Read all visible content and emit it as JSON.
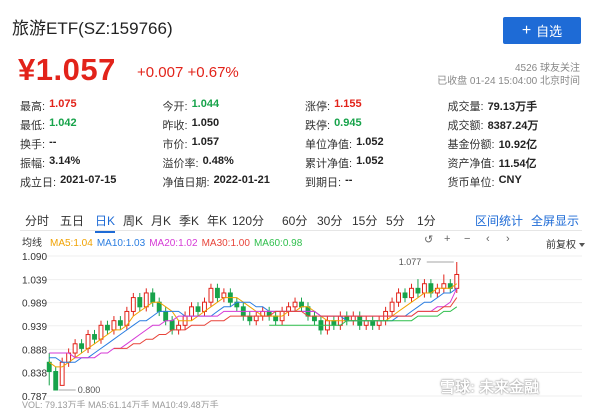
{
  "header": {
    "title": "旅游ETF(SZ:159766)",
    "add_button": "自选"
  },
  "quote": {
    "price": "¥1.057",
    "change": "+0.007 +0.67%",
    "followers": "4526 球友关注",
    "status_time": "已收盘 01-24 15:04:00 北京时间"
  },
  "stats": [
    [
      {
        "label": "最高:",
        "value": "1.075",
        "color": "red"
      },
      {
        "label": "今开:",
        "value": "1.044",
        "color": "green"
      },
      {
        "label": "涨停:",
        "value": "1.155",
        "color": "red"
      },
      {
        "label": "成交量:",
        "value": "79.13万手",
        "color": ""
      }
    ],
    [
      {
        "label": "最低:",
        "value": "1.042",
        "color": "green"
      },
      {
        "label": "昨收:",
        "value": "1.050",
        "color": ""
      },
      {
        "label": "跌停:",
        "value": "0.945",
        "color": "green"
      },
      {
        "label": "成交额:",
        "value": "8387.24万",
        "color": ""
      }
    ],
    [
      {
        "label": "换手:",
        "value": "--",
        "color": ""
      },
      {
        "label": "市价:",
        "value": "1.057",
        "color": ""
      },
      {
        "label": "单位净值:",
        "value": "1.052",
        "color": ""
      },
      {
        "label": "基金份额:",
        "value": "10.92亿",
        "color": ""
      }
    ],
    [
      {
        "label": "振幅:",
        "value": "3.14%",
        "color": ""
      },
      {
        "label": "溢价率:",
        "value": "0.48%",
        "color": ""
      },
      {
        "label": "累计净值:",
        "value": "1.052",
        "color": ""
      },
      {
        "label": "资产净值:",
        "value": "11.54亿",
        "color": ""
      }
    ],
    [
      {
        "label": "成立日:",
        "value": "2021-07-15",
        "color": ""
      },
      {
        "label": "净值日期:",
        "value": "2022-01-21",
        "color": ""
      },
      {
        "label": "到期日:",
        "value": "--",
        "color": ""
      },
      {
        "label": "货币单位:",
        "value": "CNY",
        "color": ""
      }
    ]
  ],
  "tabs": [
    "分时",
    "五日",
    "日K",
    "周K",
    "月K",
    "季K",
    "年K",
    "120分",
    "60分",
    "30分",
    "15分",
    "5分",
    "1分"
  ],
  "active_tab": "日K",
  "right_tabs": [
    "区间统计",
    "全屏显示"
  ],
  "ma_legend": {
    "mode": "均线",
    "items": [
      {
        "text": "MA5:1.04",
        "color": "#f0a202"
      },
      {
        "text": "MA10:1.03",
        "color": "#2a7de1"
      },
      {
        "text": "MA20:1.02",
        "color": "#d63ad6"
      },
      {
        "text": "MA30:1.00",
        "color": "#e8443a"
      },
      {
        "text": "MA60:0.98",
        "color": "#2fbf4c"
      }
    ]
  },
  "controls": {
    "reset": "↺",
    "zoom_in": "+",
    "zoom_out": "−",
    "prev": "‹",
    "next": "›",
    "adjust": "前复权"
  },
  "bottom_legend": "VOL: 79.13万手  MA5:61.14万手  MA10:49.48万手",
  "watermark": "雪球: 未来金融",
  "colors": {
    "up": "#e2231a",
    "down": "#17a34a",
    "accent": "#1e6bd6"
  },
  "chart_data": {
    "type": "candlestick",
    "y_ticks": [
      "1.090",
      "1.039",
      "0.989",
      "0.939",
      "0.888",
      "0.838",
      "0.787"
    ],
    "ylim": [
      0.787,
      1.09
    ],
    "high_label": "1.077",
    "low_label": "0.800",
    "candles": [
      [
        0.86,
        0.84,
        0.88,
        0.81
      ],
      [
        0.84,
        0.8,
        0.85,
        0.8
      ],
      [
        0.81,
        0.86,
        0.87,
        0.81
      ],
      [
        0.86,
        0.88,
        0.89,
        0.85
      ],
      [
        0.88,
        0.9,
        0.91,
        0.87
      ],
      [
        0.9,
        0.89,
        0.91,
        0.88
      ],
      [
        0.89,
        0.92,
        0.93,
        0.88
      ],
      [
        0.92,
        0.91,
        0.93,
        0.9
      ],
      [
        0.91,
        0.94,
        0.95,
        0.9
      ],
      [
        0.94,
        0.93,
        0.95,
        0.92
      ],
      [
        0.93,
        0.95,
        0.96,
        0.92
      ],
      [
        0.95,
        0.94,
        0.96,
        0.93
      ],
      [
        0.94,
        0.97,
        0.98,
        0.93
      ],
      [
        0.97,
        1.0,
        1.01,
        0.96
      ],
      [
        1.0,
        0.98,
        1.01,
        0.97
      ],
      [
        0.98,
        1.01,
        1.02,
        0.97
      ],
      [
        1.01,
        0.99,
        1.02,
        0.98
      ],
      [
        0.99,
        0.97,
        1.0,
        0.96
      ],
      [
        0.97,
        0.95,
        0.98,
        0.94
      ],
      [
        0.95,
        0.93,
        0.96,
        0.92
      ],
      [
        0.93,
        0.94,
        0.95,
        0.92
      ],
      [
        0.94,
        0.96,
        0.97,
        0.93
      ],
      [
        0.96,
        0.98,
        0.99,
        0.95
      ],
      [
        0.98,
        0.97,
        0.99,
        0.96
      ],
      [
        0.97,
        0.99,
        1.0,
        0.96
      ],
      [
        0.99,
        1.02,
        1.03,
        0.98
      ],
      [
        1.02,
        1.0,
        1.03,
        0.99
      ],
      [
        1.0,
        1.01,
        1.02,
        0.99
      ],
      [
        1.01,
        0.99,
        1.02,
        0.98
      ],
      [
        0.99,
        0.98,
        1.0,
        0.97
      ],
      [
        0.98,
        0.96,
        0.99,
        0.95
      ],
      [
        0.96,
        0.95,
        0.97,
        0.94
      ],
      [
        0.95,
        0.96,
        0.97,
        0.94
      ],
      [
        0.96,
        0.97,
        0.98,
        0.95
      ],
      [
        0.97,
        0.96,
        0.98,
        0.95
      ],
      [
        0.96,
        0.95,
        0.97,
        0.94
      ],
      [
        0.95,
        0.97,
        0.98,
        0.94
      ],
      [
        0.97,
        0.98,
        0.99,
        0.96
      ],
      [
        0.98,
        0.99,
        1.0,
        0.97
      ],
      [
        0.99,
        0.98,
        1.0,
        0.97
      ],
      [
        0.98,
        0.96,
        0.99,
        0.95
      ],
      [
        0.96,
        0.95,
        0.97,
        0.94
      ],
      [
        0.95,
        0.93,
        0.96,
        0.92
      ],
      [
        0.93,
        0.95,
        0.96,
        0.92
      ],
      [
        0.95,
        0.94,
        0.96,
        0.93
      ],
      [
        0.94,
        0.96,
        0.97,
        0.93
      ],
      [
        0.96,
        0.95,
        0.97,
        0.94
      ],
      [
        0.95,
        0.96,
        0.97,
        0.94
      ],
      [
        0.96,
        0.94,
        0.97,
        0.93
      ],
      [
        0.94,
        0.95,
        0.96,
        0.93
      ],
      [
        0.95,
        0.94,
        0.96,
        0.93
      ],
      [
        0.94,
        0.95,
        0.96,
        0.93
      ],
      [
        0.95,
        0.97,
        0.98,
        0.94
      ],
      [
        0.97,
        0.99,
        1.0,
        0.96
      ],
      [
        0.99,
        1.01,
        1.02,
        0.98
      ],
      [
        1.01,
        1.0,
        1.02,
        0.99
      ],
      [
        1.0,
        1.02,
        1.03,
        0.99
      ],
      [
        1.02,
        1.01,
        1.04,
        1.0
      ],
      [
        1.01,
        1.03,
        1.04,
        1.0
      ],
      [
        1.03,
        1.01,
        1.04,
        1.0
      ],
      [
        1.01,
        1.02,
        1.03,
        1.0
      ],
      [
        1.02,
        1.03,
        1.05,
        1.01
      ],
      [
        1.03,
        1.02,
        1.04,
        1.01
      ],
      [
        1.02,
        1.05,
        1.077,
        1.01
      ]
    ],
    "ma_series": [
      {
        "name": "MA5",
        "color": "#f0a202",
        "values": [
          0.86,
          0.85,
          0.85,
          0.86,
          0.87,
          0.88,
          0.89,
          0.9,
          0.91,
          0.92,
          0.93,
          0.93,
          0.94,
          0.96,
          0.97,
          0.98,
          0.99,
          0.99,
          0.98,
          0.97,
          0.95,
          0.95,
          0.95,
          0.96,
          0.97,
          0.98,
          0.99,
          1.0,
          1.0,
          1.0,
          0.99,
          0.98,
          0.97,
          0.96,
          0.96,
          0.96,
          0.96,
          0.97,
          0.97,
          0.98,
          0.98,
          0.97,
          0.96,
          0.95,
          0.95,
          0.95,
          0.95,
          0.95,
          0.95,
          0.95,
          0.95,
          0.95,
          0.95,
          0.96,
          0.97,
          0.98,
          0.99,
          1.0,
          1.01,
          1.01,
          1.02,
          1.02,
          1.02,
          1.03
        ]
      },
      {
        "name": "MA10",
        "color": "#2a7de1",
        "values": [
          0.87,
          0.87,
          0.86,
          0.86,
          0.86,
          0.87,
          0.87,
          0.88,
          0.89,
          0.9,
          0.91,
          0.92,
          0.93,
          0.94,
          0.95,
          0.95,
          0.96,
          0.97,
          0.97,
          0.97,
          0.97,
          0.96,
          0.96,
          0.96,
          0.96,
          0.96,
          0.97,
          0.98,
          0.98,
          0.99,
          0.99,
          0.99,
          0.98,
          0.98,
          0.97,
          0.97,
          0.97,
          0.97,
          0.97,
          0.97,
          0.97,
          0.97,
          0.96,
          0.96,
          0.96,
          0.96,
          0.95,
          0.95,
          0.95,
          0.95,
          0.95,
          0.95,
          0.95,
          0.95,
          0.96,
          0.96,
          0.97,
          0.98,
          0.99,
          0.99,
          1.0,
          1.01,
          1.01,
          1.02
        ]
      },
      {
        "name": "MA20",
        "color": "#d63ad6",
        "values": [
          0.88,
          0.88,
          0.88,
          0.88,
          0.87,
          0.87,
          0.87,
          0.87,
          0.88,
          0.88,
          0.89,
          0.89,
          0.9,
          0.91,
          0.92,
          0.93,
          0.94,
          0.94,
          0.95,
          0.95,
          0.96,
          0.96,
          0.96,
          0.96,
          0.96,
          0.96,
          0.96,
          0.97,
          0.97,
          0.97,
          0.97,
          0.97,
          0.97,
          0.97,
          0.97,
          0.97,
          0.97,
          0.97,
          0.97,
          0.97,
          0.97,
          0.97,
          0.96,
          0.96,
          0.96,
          0.96,
          0.96,
          0.96,
          0.96,
          0.96,
          0.96,
          0.96,
          0.96,
          0.96,
          0.96,
          0.96,
          0.96,
          0.97,
          0.97,
          0.97,
          0.98,
          0.98,
          0.99,
          1.02
        ]
      },
      {
        "name": "MA30",
        "color": "#e8443a",
        "values": [
          null,
          null,
          null,
          null,
          null,
          null,
          null,
          null,
          null,
          null,
          0.89,
          0.89,
          0.89,
          0.9,
          0.9,
          0.91,
          0.91,
          0.92,
          0.92,
          0.93,
          0.93,
          0.93,
          0.94,
          0.94,
          0.94,
          0.95,
          0.95,
          0.95,
          0.96,
          0.96,
          0.96,
          0.96,
          0.96,
          0.96,
          0.96,
          0.97,
          0.97,
          0.97,
          0.97,
          0.97,
          0.96,
          0.96,
          0.96,
          0.96,
          0.96,
          0.96,
          0.96,
          0.96,
          0.96,
          0.96,
          0.96,
          0.96,
          0.96,
          0.96,
          0.96,
          0.96,
          0.96,
          0.97,
          0.97,
          0.97,
          0.97,
          0.98,
          0.98,
          1.0
        ]
      },
      {
        "name": "MA60",
        "color": "#2fbf4c",
        "values": [
          null,
          null,
          null,
          null,
          null,
          null,
          null,
          null,
          null,
          null,
          null,
          null,
          null,
          null,
          null,
          null,
          null,
          null,
          null,
          null,
          null,
          null,
          null,
          null,
          null,
          null,
          null,
          null,
          null,
          null,
          null,
          null,
          null,
          null,
          0.94,
          0.94,
          0.94,
          0.94,
          0.94,
          0.94,
          0.94,
          0.94,
          0.94,
          0.94,
          0.94,
          0.94,
          0.95,
          0.95,
          0.95,
          0.95,
          0.95,
          0.95,
          0.95,
          0.95,
          0.95,
          0.95,
          0.95,
          0.96,
          0.96,
          0.96,
          0.96,
          0.97,
          0.97,
          0.98
        ]
      }
    ]
  }
}
